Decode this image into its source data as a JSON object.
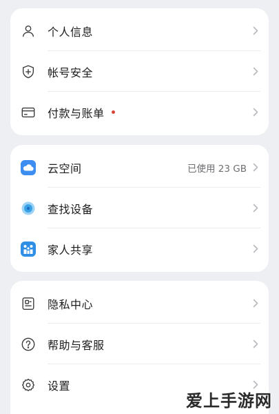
{
  "colors": {
    "background": "#eeeff2",
    "card": "#ffffff",
    "cloud_icon": "#3d8ef0",
    "find_icon": "#3aa3e8",
    "family_icon": "#2f8fe6",
    "red_dot": "#d8453a"
  },
  "sections": [
    {
      "items": [
        {
          "icon": "person-icon",
          "label": "个人信息"
        },
        {
          "icon": "shield-icon",
          "label": "帐号安全"
        },
        {
          "icon": "card-icon",
          "label": "付款与账单",
          "badge": "red-dot"
        }
      ]
    },
    {
      "items": [
        {
          "icon": "cloud-icon",
          "label": "云空间",
          "value": "已使用 23 GB"
        },
        {
          "icon": "find-device-icon",
          "label": "查找设备"
        },
        {
          "icon": "family-icon",
          "label": "家人共享"
        }
      ]
    },
    {
      "items": [
        {
          "icon": "privacy-icon",
          "label": "隐私中心"
        },
        {
          "icon": "help-icon",
          "label": "帮助与客服"
        },
        {
          "icon": "settings-icon",
          "label": "设置"
        }
      ]
    }
  ],
  "watermark": "爱上手游网"
}
